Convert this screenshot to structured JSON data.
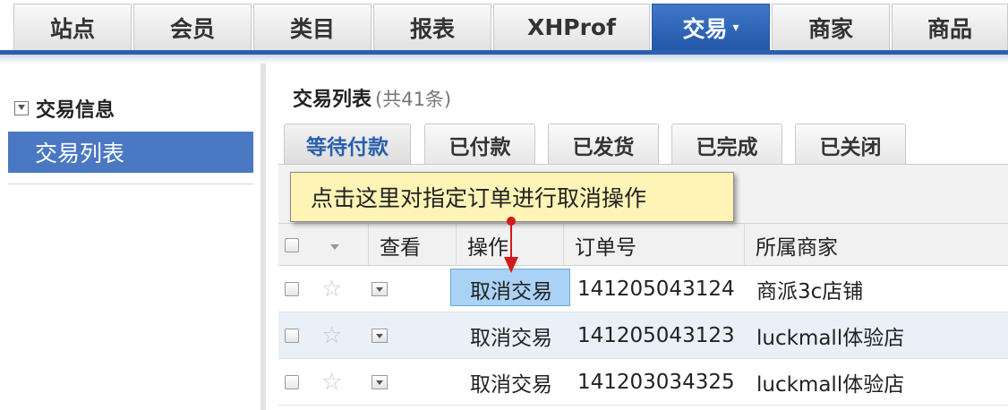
{
  "topnav": {
    "tabs": [
      {
        "label": "站点"
      },
      {
        "label": "会员"
      },
      {
        "label": "类目"
      },
      {
        "label": "报表"
      },
      {
        "label": "XHProf"
      },
      {
        "label": "交易",
        "active": true
      },
      {
        "label": "商家"
      },
      {
        "label": "商品"
      }
    ],
    "active_caret": "▾"
  },
  "sidebar": {
    "group_label": "交易信息",
    "items": [
      {
        "label": "交易列表",
        "active": true
      }
    ]
  },
  "main": {
    "title": "交易列表",
    "count": "(共41条)",
    "tabs": [
      {
        "label": "等待付款",
        "active": true
      },
      {
        "label": "已付款"
      },
      {
        "label": "已发货"
      },
      {
        "label": "已完成"
      },
      {
        "label": "已关闭"
      }
    ],
    "tooltip": "点击这里对指定订单进行取消操作",
    "table": {
      "columns": [
        "查看",
        "操作",
        "订单号",
        "所属商家"
      ],
      "rows": [
        {
          "action": "取消交易",
          "order_no": "141205043124",
          "merchant": "商派3c店铺"
        },
        {
          "action": "取消交易",
          "order_no": "141205043123",
          "merchant": "luckmall体验店"
        },
        {
          "action": "取消交易",
          "order_no": "141203034325",
          "merchant": "luckmall体验店"
        }
      ]
    }
  },
  "colors": {
    "accent": "#2c5fae",
    "active_tab": "#3f77c9",
    "sidebar_active": "#4a78c2",
    "tooltip_bg": "#fdf4b6",
    "highlight": "#a9d2f6",
    "arrow": "#d11a1a"
  },
  "icons": [
    "collapse-icon",
    "star-icon",
    "view-detail-icon",
    "checkbox",
    "sort-caret-icon",
    "arrow-annotation"
  ]
}
